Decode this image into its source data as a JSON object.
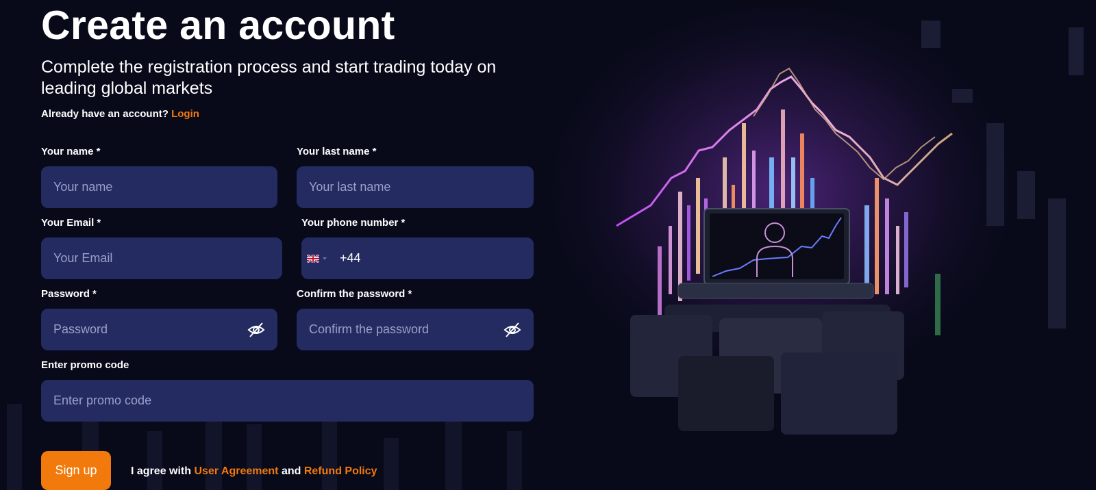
{
  "header": {
    "title": "Create an account",
    "subtitle": "Complete the registration process and start trading today on leading global markets",
    "login_prompt": "Already have an account?",
    "login_link": "Login"
  },
  "form": {
    "first_name": {
      "label": "Your name *",
      "placeholder": "Your name"
    },
    "last_name": {
      "label": "Your last name *",
      "placeholder": "Your last name"
    },
    "email": {
      "label": "Your Email *",
      "placeholder": "Your Email"
    },
    "phone": {
      "label": "Your phone number *",
      "value": "+44",
      "country_icon": "uk-flag-icon"
    },
    "password": {
      "label": "Password *",
      "placeholder": "Password"
    },
    "confirm_password": {
      "label": "Confirm the password *",
      "placeholder": "Confirm the password"
    },
    "promo": {
      "label": "Enter promo code",
      "placeholder": "Enter promo code"
    }
  },
  "actions": {
    "signup_label": "Sign up",
    "agree_prefix": "I agree with",
    "user_agreement": "User Agreement",
    "and": "and",
    "refund_policy": "Refund Policy"
  },
  "colors": {
    "background": "#080a1a",
    "input_bg": "#232b61",
    "accent": "#f27a0c",
    "placeholder": "#9aa0c8"
  },
  "icons": {
    "eye": "eye-hidden-icon",
    "hero": "trading-laptop-illustration"
  }
}
